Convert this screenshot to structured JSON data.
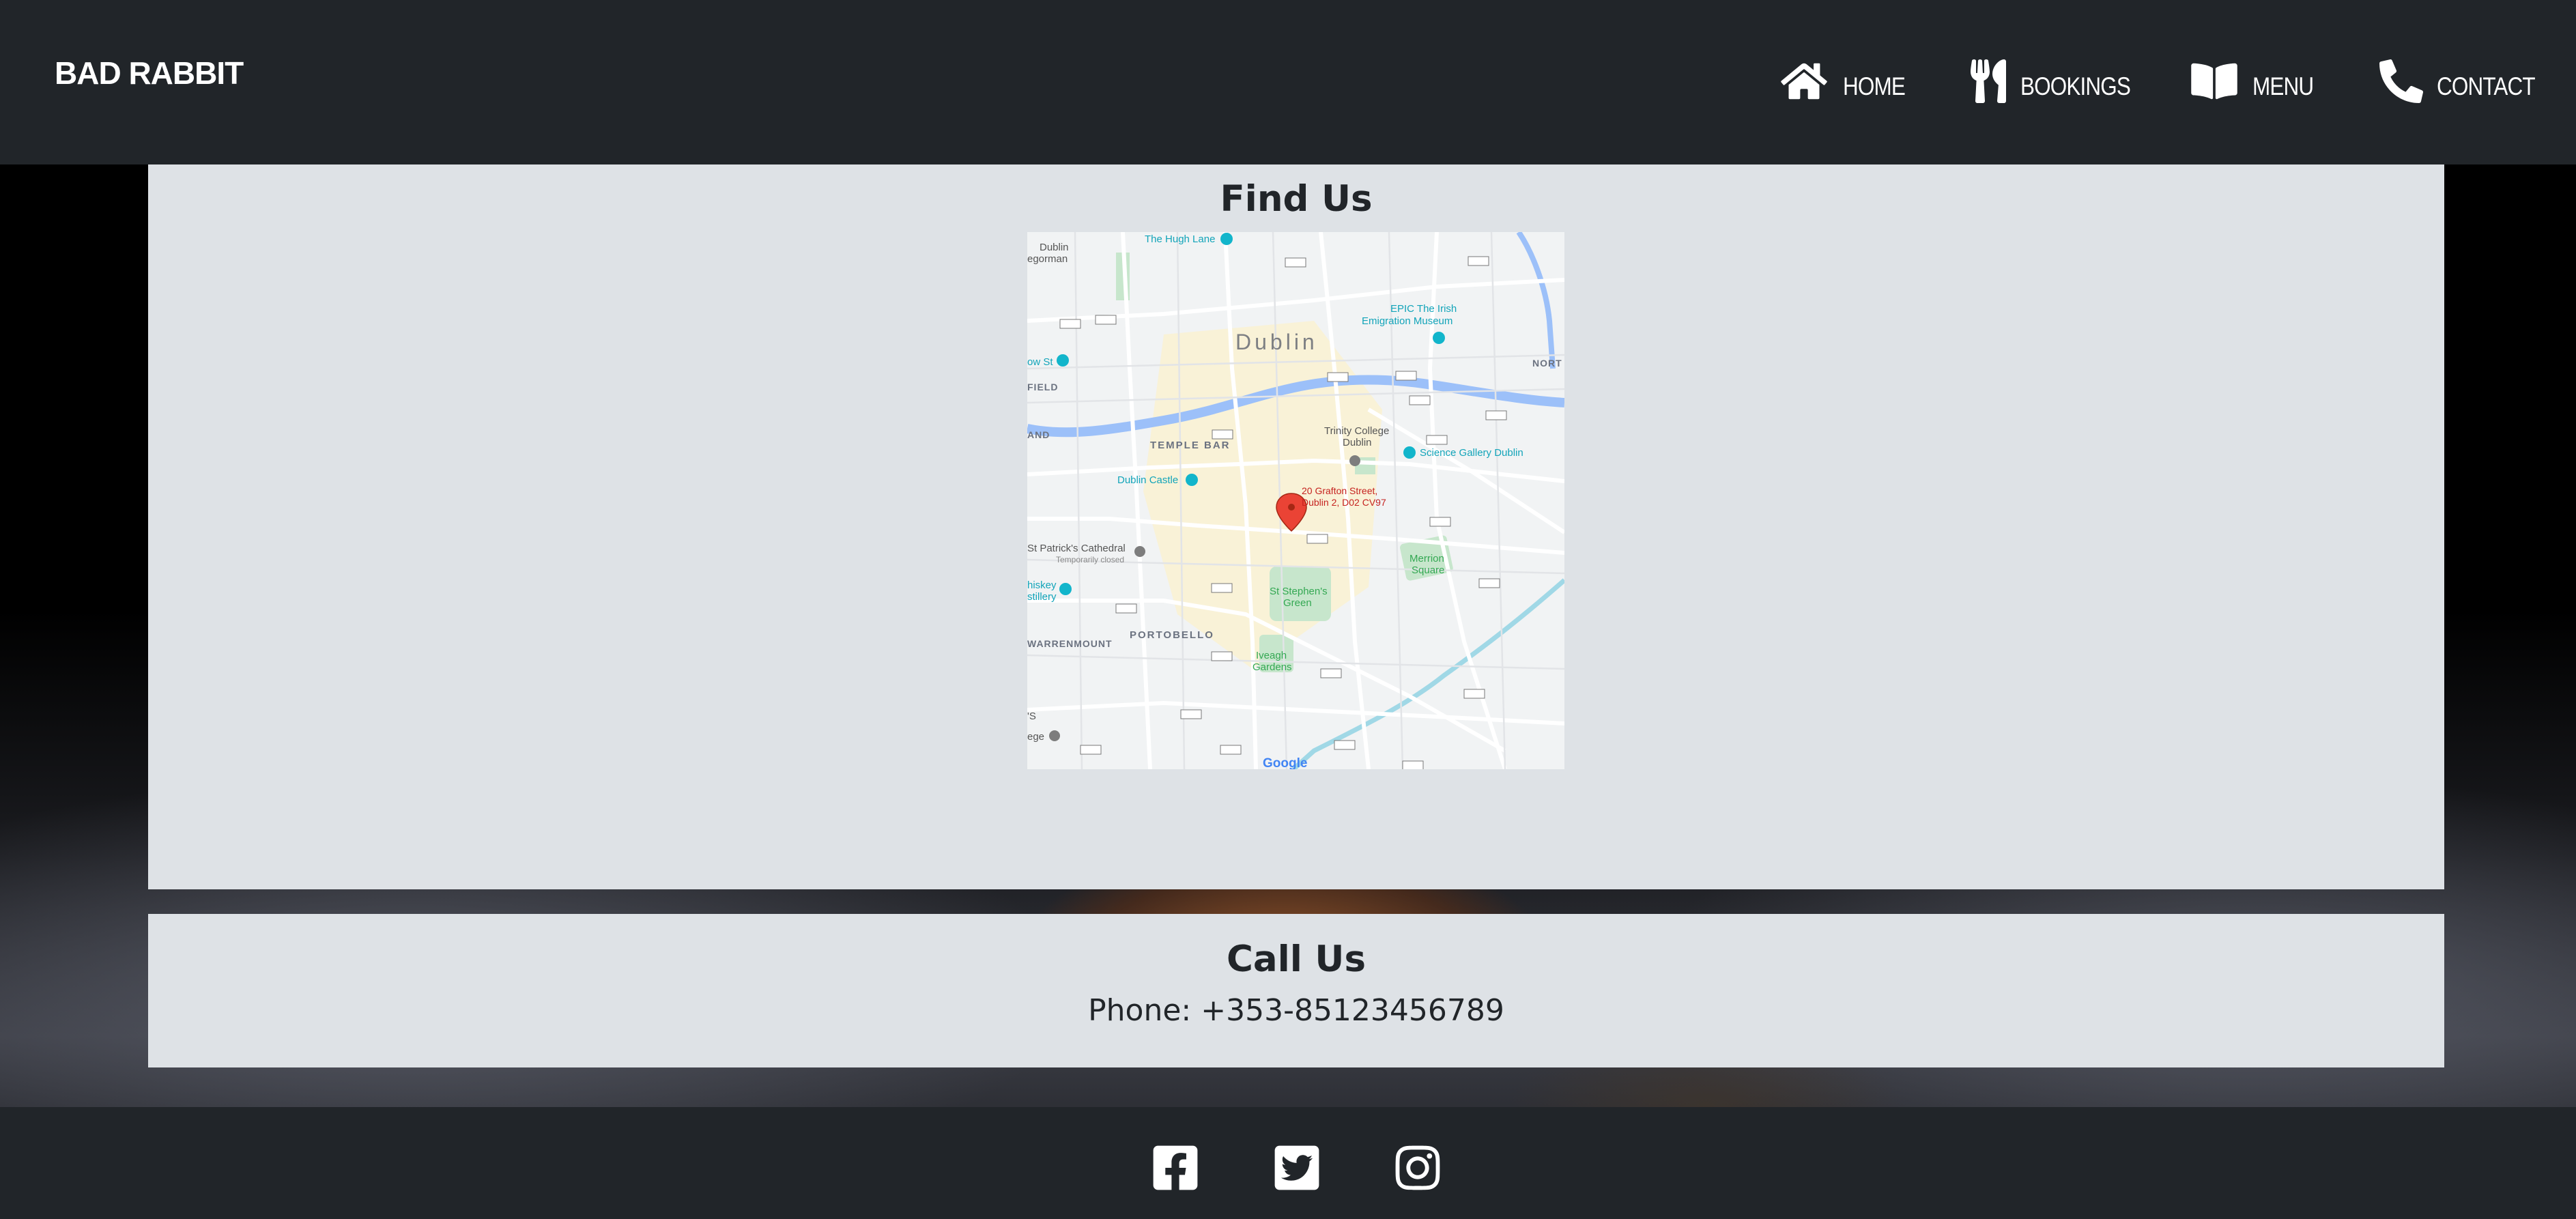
{
  "brand": "BAD RABBIT",
  "nav": {
    "home": "HOME",
    "bookings": "BOOKINGS",
    "menu": "MENU",
    "contact": "CONTACT"
  },
  "find_us": {
    "title": "Find Us",
    "map": {
      "marker_line1": "20 Grafton Street,",
      "marker_line2": "Dublin 2, D02 CV97",
      "labels": {
        "dublin": "Dublin",
        "temple_bar": "TEMPLE BAR",
        "portobello": "PORTOBELLO",
        "warrenmount": "WARRENMOUNT",
        "hugh_lane": "The Hugh Lane",
        "epic1": "EPIC The Irish",
        "epic2": "Emigration Museum",
        "trinity1": "Trinity College",
        "trinity2": "Dublin",
        "science": "Science Gallery Dublin",
        "castle": "Dublin Castle",
        "patricks": "St Patrick's Cathedral",
        "patricks_note": "Temporarily closed",
        "stephens1": "St Stephen's",
        "stephens2": "Green",
        "merrion1": "Merrion",
        "merrion2": "Square",
        "iveagh1": "Iveagh",
        "iveagh2": "Gardens",
        "whiskey1": "hiskey",
        "whiskey2": "stillery",
        "north": "NORT",
        "field": "FIELD",
        "and": "AND",
        "ow_st": "ow St",
        "dublin_gal1": "Dublin",
        "dublin_gal2": "egorman",
        "s": "'S",
        "ege": "ege",
        "google": "Google"
      }
    }
  },
  "call_us": {
    "title": "Call Us",
    "phone": "Phone: +353-85123456789"
  },
  "colors": {
    "navbar": "#212529",
    "panel": "#dee2e6",
    "text": "#212529",
    "marker": "#ea4335"
  },
  "icons": {
    "home": "home-icon",
    "bookings": "utensils-icon",
    "menu": "book-open-icon",
    "contact": "phone-icon",
    "facebook": "facebook-icon",
    "twitter": "twitter-icon",
    "instagram": "instagram-icon"
  }
}
